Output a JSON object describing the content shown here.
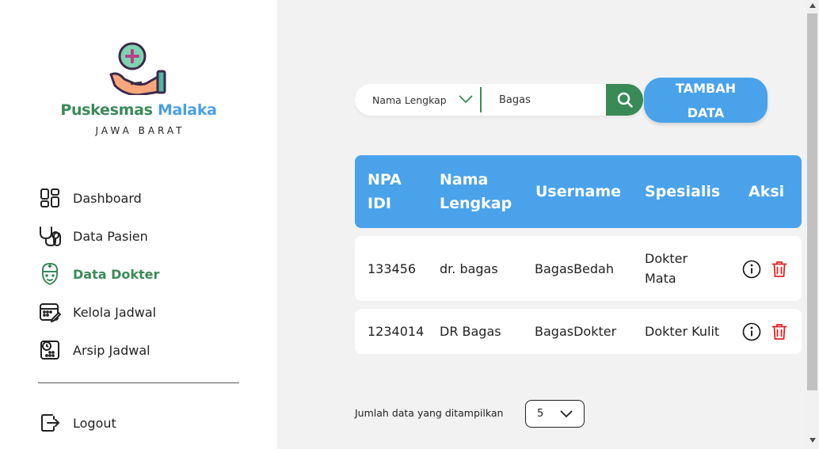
{
  "sidebar": {
    "brand_part1": "Puskesmas",
    "brand_part2": "Malaka",
    "region": "JAWA BARAT",
    "items": [
      {
        "label": "Dashboard",
        "icon": "dashboard-grid-icon"
      },
      {
        "label": "Data Pasien",
        "icon": "stethoscope-icon"
      },
      {
        "label": "Data Dokter",
        "icon": "doctor-icon",
        "active": true
      },
      {
        "label": "Kelola Jadwal",
        "icon": "calendar-edit-icon"
      },
      {
        "label": "Arsip Jadwal",
        "icon": "calendar-clock-icon"
      }
    ],
    "logout_label": "Logout"
  },
  "toolbar": {
    "filter_value": "Nama Lengkap",
    "search_value": "Bagas",
    "add_label_line1": "TAMBAH",
    "add_label_line2": "DATA"
  },
  "table": {
    "headers": {
      "npa_line1": "NPA",
      "npa_line2": "IDI",
      "nama_line1": "Nama",
      "nama_line2": "Lengkap",
      "username": "Username",
      "spesialis": "Spesialis",
      "aksi": "Aksi"
    },
    "rows": [
      {
        "npa": "133456",
        "nama": "dr. bagas",
        "username": "BagasBedah",
        "spesialis_line1": "Dokter",
        "spesialis_line2": "Mata"
      },
      {
        "npa": "1234014",
        "nama": "DR Bagas",
        "username": "BagasDokter",
        "spesialis": "Dokter Kulit"
      }
    ]
  },
  "pager": {
    "label": "Jumlah data yang ditampilkan",
    "value": "5"
  },
  "colors": {
    "green": "#3a8a57",
    "blue": "#4aa3ea",
    "delete": "#e02424"
  }
}
